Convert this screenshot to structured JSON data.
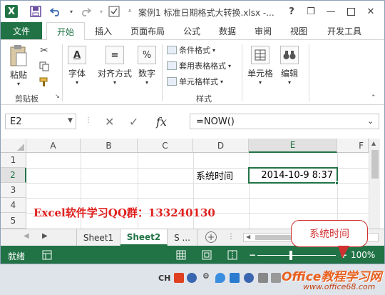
{
  "window": {
    "title": "案例1 标准日期格式大转换.xlsx -...",
    "help": "?",
    "minimize": "—",
    "restore": "❐",
    "close": "✕"
  },
  "quick_access": {
    "save_icon": "save-icon",
    "undo_icon": "undo-icon",
    "redo_icon": "redo-icon"
  },
  "tabs": {
    "file": "文件",
    "items": [
      "开始",
      "插入",
      "页面布局",
      "公式",
      "数据",
      "审阅",
      "视图",
      "开发工具"
    ],
    "active": "开始"
  },
  "ribbon": {
    "paste": "粘贴",
    "clipboard_group": "剪贴板",
    "font": "字体",
    "alignment": "对齐方式",
    "number": "数字",
    "number_symbol": "%",
    "conditional_format": "条件格式",
    "table_format": "套用表格格式",
    "cell_style": "单元格样式",
    "styles_group": "样式",
    "cells": "单元格",
    "editing": "编辑"
  },
  "formula_bar": {
    "name_box": "E2",
    "fx": "fx",
    "formula": "=NOW()"
  },
  "grid": {
    "columns": [
      "A",
      "B",
      "C",
      "D",
      "E",
      "F"
    ],
    "rows": [
      "1",
      "2",
      "3",
      "4",
      "5"
    ],
    "selected_column": "E",
    "selected_row": "2",
    "d2": "系统时间",
    "e2": "2014-10-9 8:37",
    "overlay_text": "Excel软件学习QQ群：133240130"
  },
  "sheets": {
    "tabs": [
      "Sheet1",
      "Sheet2",
      "S ..."
    ],
    "active": "Sheet2",
    "add": "+"
  },
  "status": {
    "ready": "就绪",
    "zoom": "100%"
  },
  "callout": "系统时间",
  "taskbar": {
    "ime": "CH",
    "watermark_cn": "Office教程学习网",
    "watermark_url": "www.office68.com"
  }
}
